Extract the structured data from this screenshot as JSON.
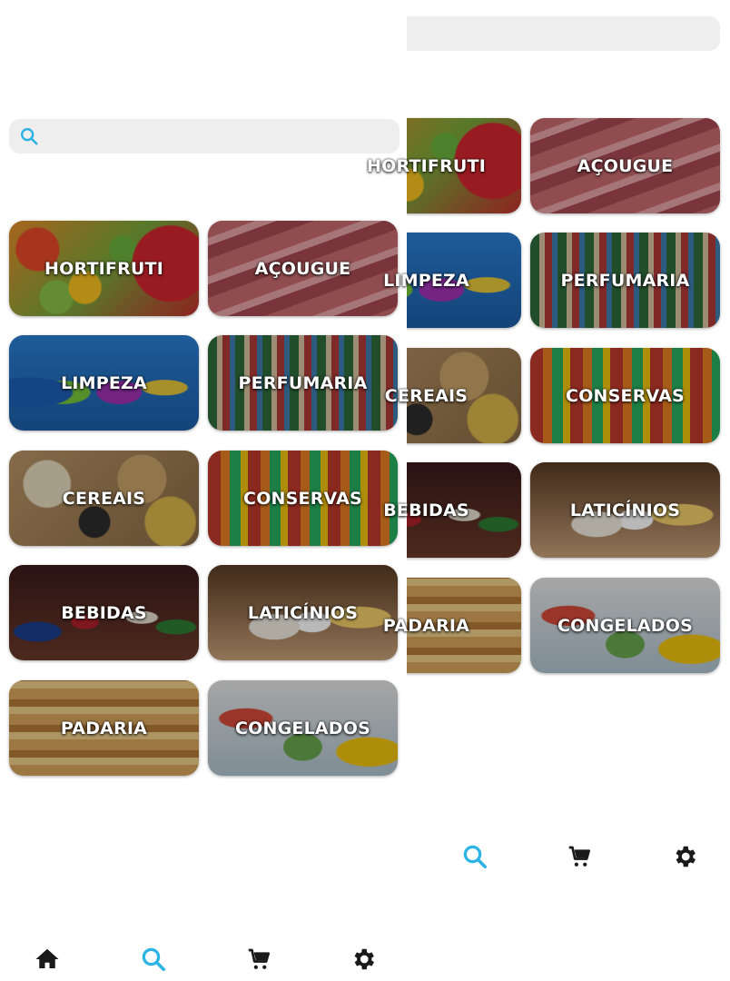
{
  "search": {
    "placeholder": ""
  },
  "categories": [
    {
      "label": "HORTIFRUTI"
    },
    {
      "label": "AÇOUGUE"
    },
    {
      "label": "LIMPEZA"
    },
    {
      "label": "PERFUMARIA"
    },
    {
      "label": "CEREAIS"
    },
    {
      "label": "CONSERVAS"
    },
    {
      "label": "BEBIDAS"
    },
    {
      "label": "LATICÍNIOS"
    },
    {
      "label": "PADARIA"
    },
    {
      "label": "CONGELADOS"
    }
  ],
  "bottom_nav": {
    "items": [
      {
        "icon": "home-icon"
      },
      {
        "icon": "search-icon",
        "active": true
      },
      {
        "icon": "cart-icon"
      },
      {
        "icon": "gear-icon"
      }
    ],
    "active_color": "#2bb3e6",
    "icon_color": "#1a1a1a"
  },
  "colors": {
    "accent": "#2bb3e6",
    "search_bg": "#eeeeee"
  }
}
